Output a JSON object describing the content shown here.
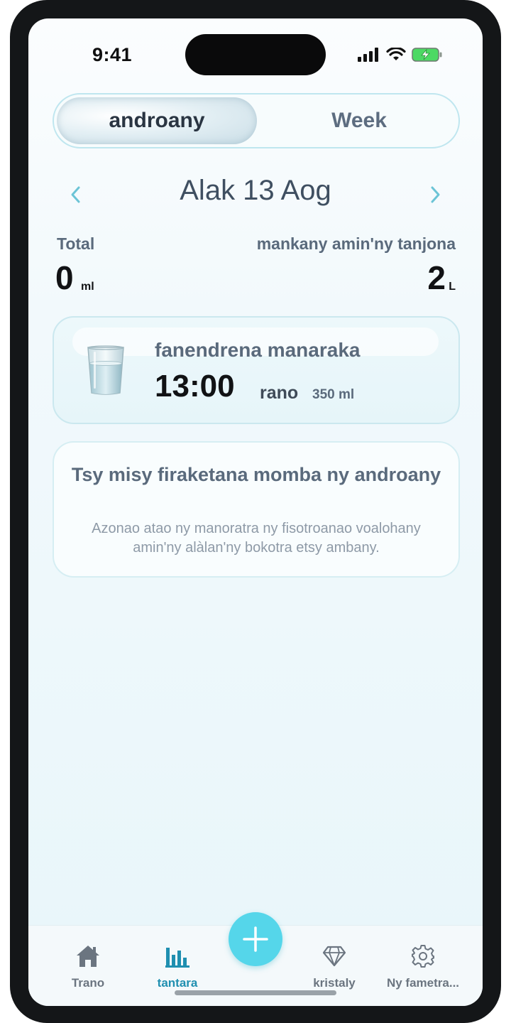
{
  "status_bar": {
    "time": "9:41"
  },
  "segmented": {
    "day_label": "androany",
    "week_label": "Week",
    "selected": "androany"
  },
  "date_nav": {
    "title": "Alak 13 Aog"
  },
  "summary": {
    "total_label": "Total",
    "total_value": "0",
    "total_unit": "ml",
    "goal_label": "mankany amin'ny tanjona",
    "goal_value": "2",
    "goal_unit": "L"
  },
  "reminder": {
    "title": "fanendrena manaraka",
    "time": "13:00",
    "period": "rano",
    "amount": "350 ml"
  },
  "empty_state": {
    "title": "Tsy misy firaketana momba ny androany",
    "text": "Azonao atao ny manoratra ny fisotroanao voalohany amin'ny alàlan'ny bokotra etsy ambany."
  },
  "tab_bar": {
    "items": [
      {
        "label": "Trano",
        "icon": "house-icon"
      },
      {
        "label": "tantara",
        "icon": "bar-chart-icon",
        "active": true
      },
      {
        "label": "kristaly",
        "icon": "diamond-icon"
      },
      {
        "label": "Ny fametra...",
        "icon": "gear-icon"
      }
    ],
    "add_icon": "plus-icon"
  },
  "colors": {
    "accent": "#55d6ea",
    "active_tab": "#1f8fb0",
    "text_dark": "#111214",
    "text_muted": "#5a6a7c"
  }
}
